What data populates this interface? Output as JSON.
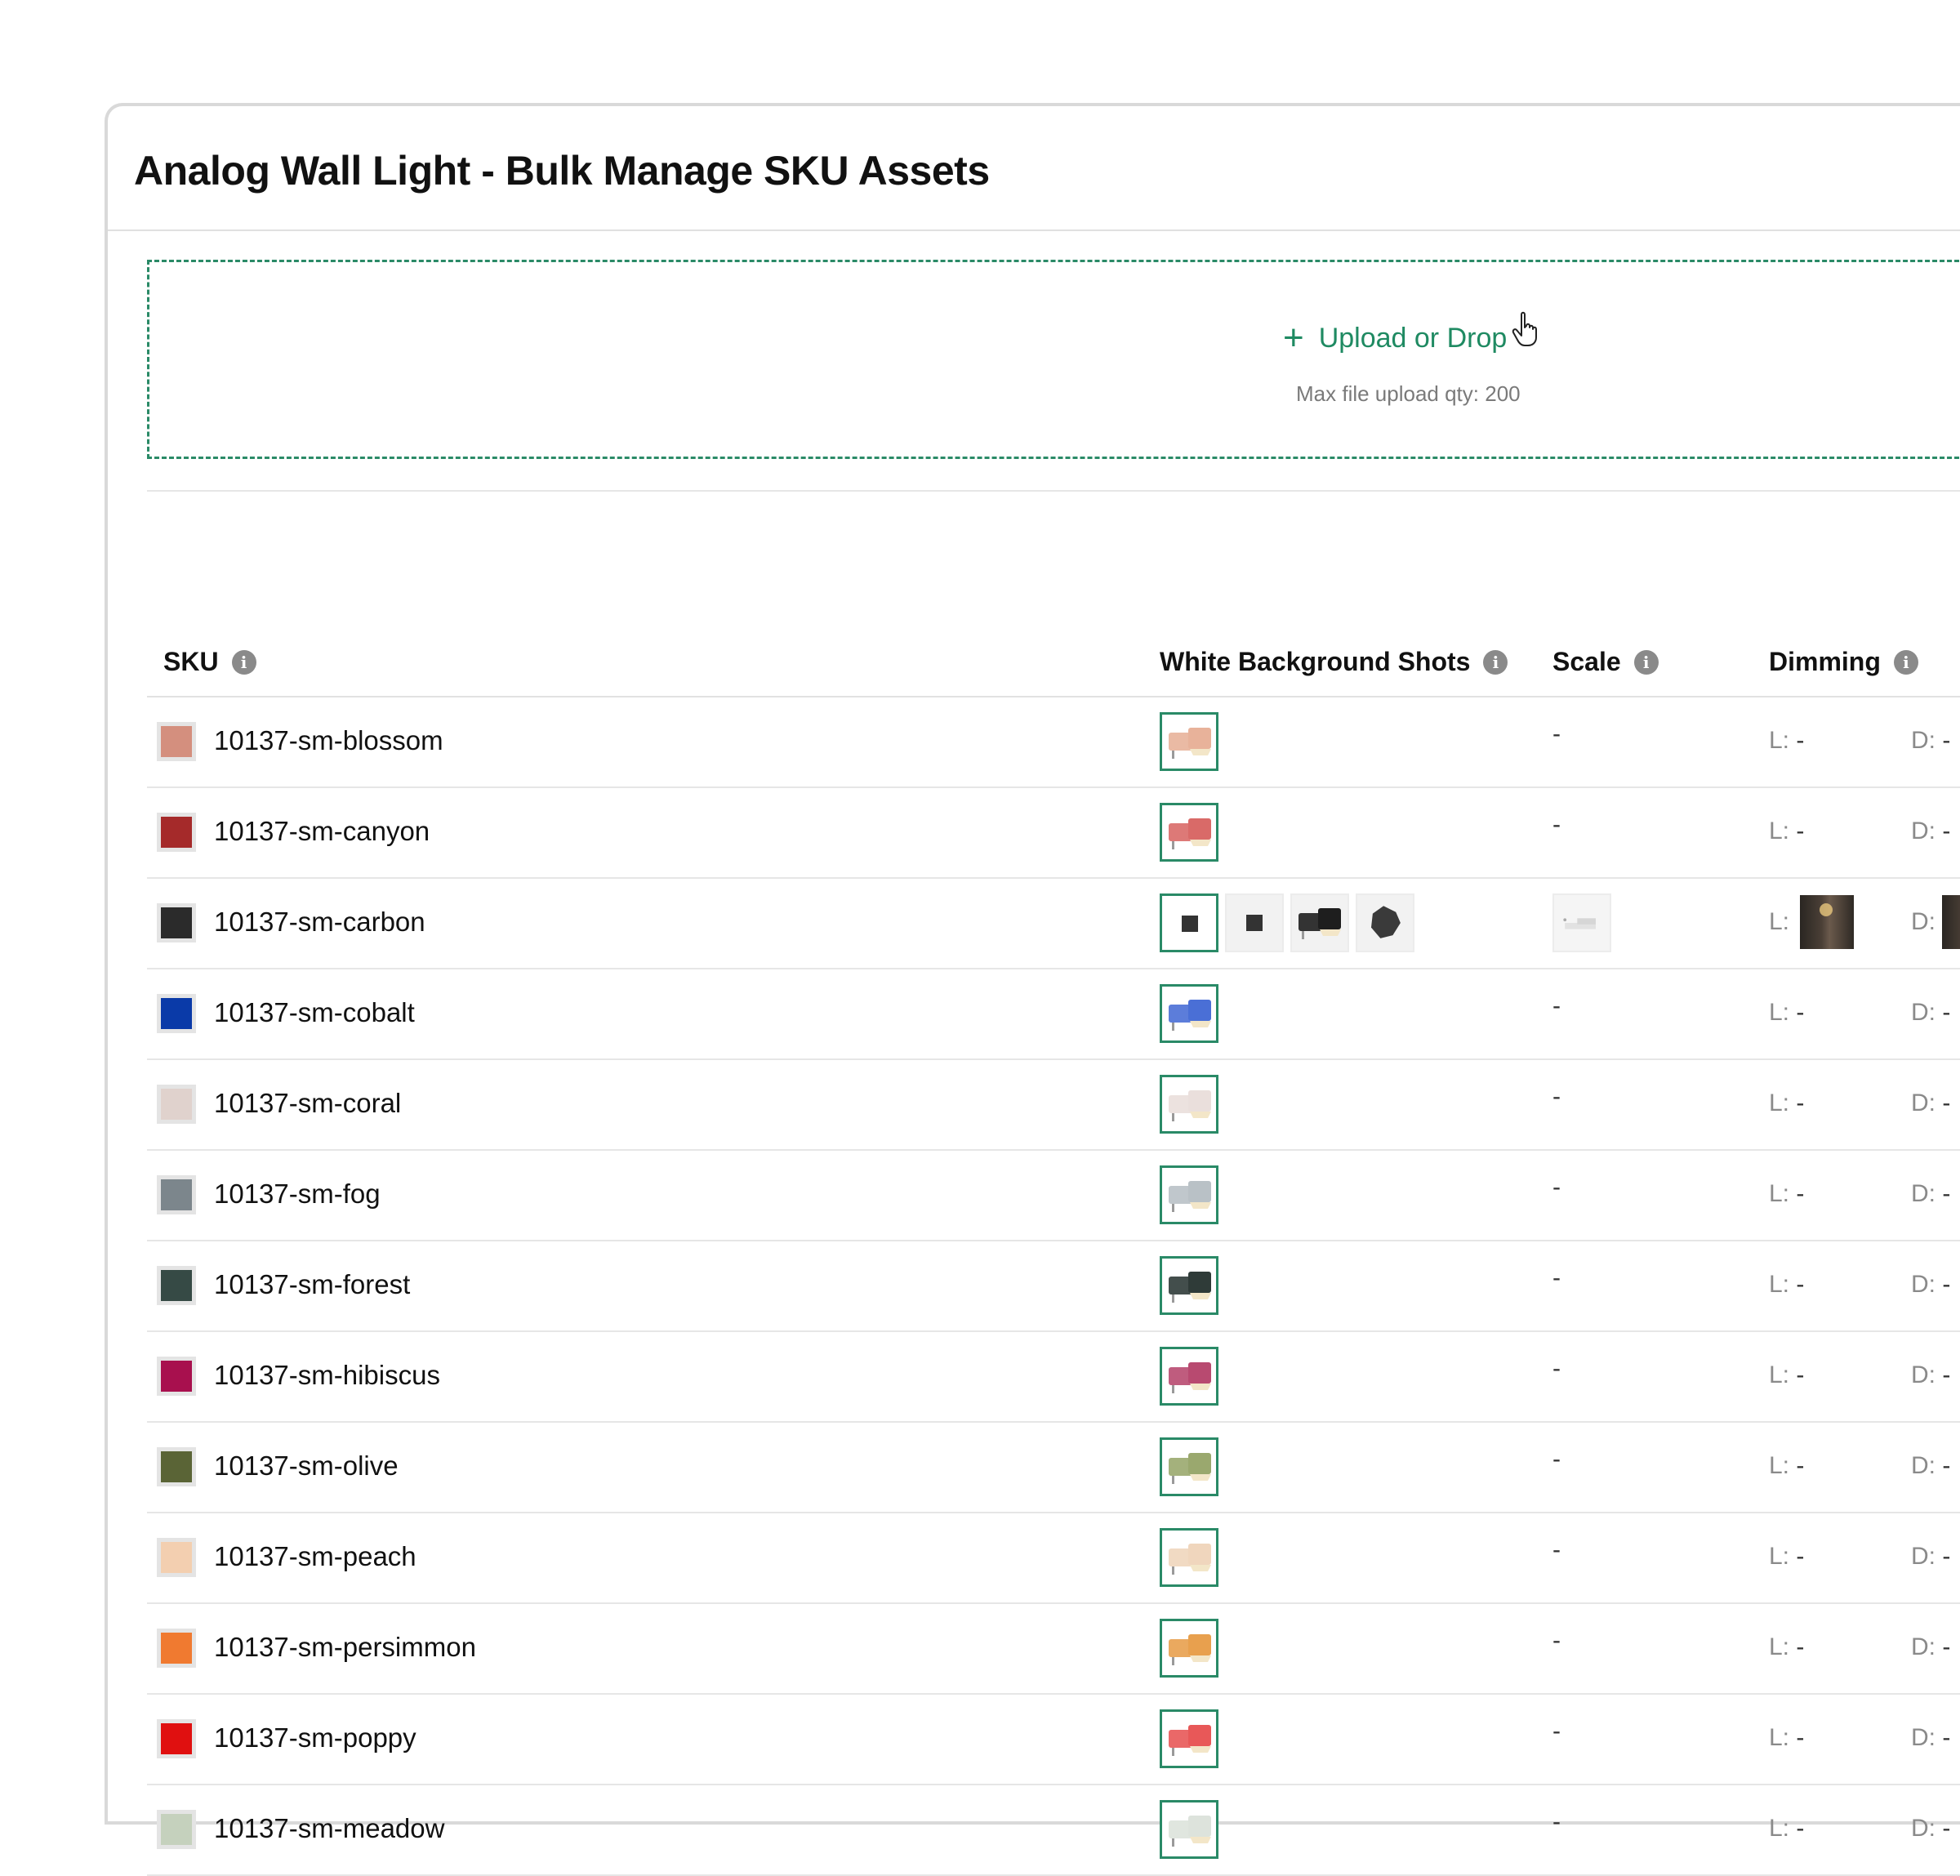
{
  "title": "Analog Wall Light - Bulk Manage SKU Assets",
  "upload": {
    "label": "Upload or Drop",
    "note": "Max file upload qty: 200"
  },
  "columns": {
    "sku": "SKU",
    "white_bg": "White Background Shots",
    "scale": "Scale",
    "dimming": "Dimming"
  },
  "dimming_labels": {
    "light": "L:",
    "dark": "D:",
    "empty": "-"
  },
  "rows": [
    {
      "sku": "10137-sm-blossom",
      "swatch": "#d48f7e",
      "lamp": "#e8b29a",
      "scale": "-"
    },
    {
      "sku": "10137-sm-canyon",
      "swatch": "#a52a2a",
      "lamp": "#d96a68",
      "scale": "-"
    },
    {
      "sku": "10137-sm-carbon",
      "swatch": "#2b2b2b",
      "lamp": "#222222",
      "scale": "",
      "extra": true
    },
    {
      "sku": "10137-sm-cobalt",
      "swatch": "#0a3aa8",
      "lamp": "#4a6fd6",
      "scale": "-"
    },
    {
      "sku": "10137-sm-coral",
      "swatch": "#e0d2cd",
      "lamp": "#eadfdc",
      "scale": "-"
    },
    {
      "sku": "10137-sm-fog",
      "swatch": "#7c868c",
      "lamp": "#b9c1c6",
      "scale": "-"
    },
    {
      "sku": "10137-sm-forest",
      "swatch": "#364a45",
      "lamp": "#2f3b38",
      "scale": "-"
    },
    {
      "sku": "10137-sm-hibiscus",
      "swatch": "#a8104e",
      "lamp": "#b84a70",
      "scale": "-"
    },
    {
      "sku": "10137-sm-olive",
      "swatch": "#5a6436",
      "lamp": "#9aa86e",
      "scale": "-"
    },
    {
      "sku": "10137-sm-peach",
      "swatch": "#f3cfb0",
      "lamp": "#f0d6bd",
      "scale": "-"
    },
    {
      "sku": "10137-sm-persimmon",
      "swatch": "#f07a30",
      "lamp": "#e8a04e",
      "scale": "-"
    },
    {
      "sku": "10137-sm-poppy",
      "swatch": "#e01010",
      "lamp": "#e85858",
      "scale": "-"
    },
    {
      "sku": "10137-sm-meadow",
      "swatch": "#c5d1bd",
      "lamp": "#dde3dc",
      "scale": "-"
    }
  ]
}
